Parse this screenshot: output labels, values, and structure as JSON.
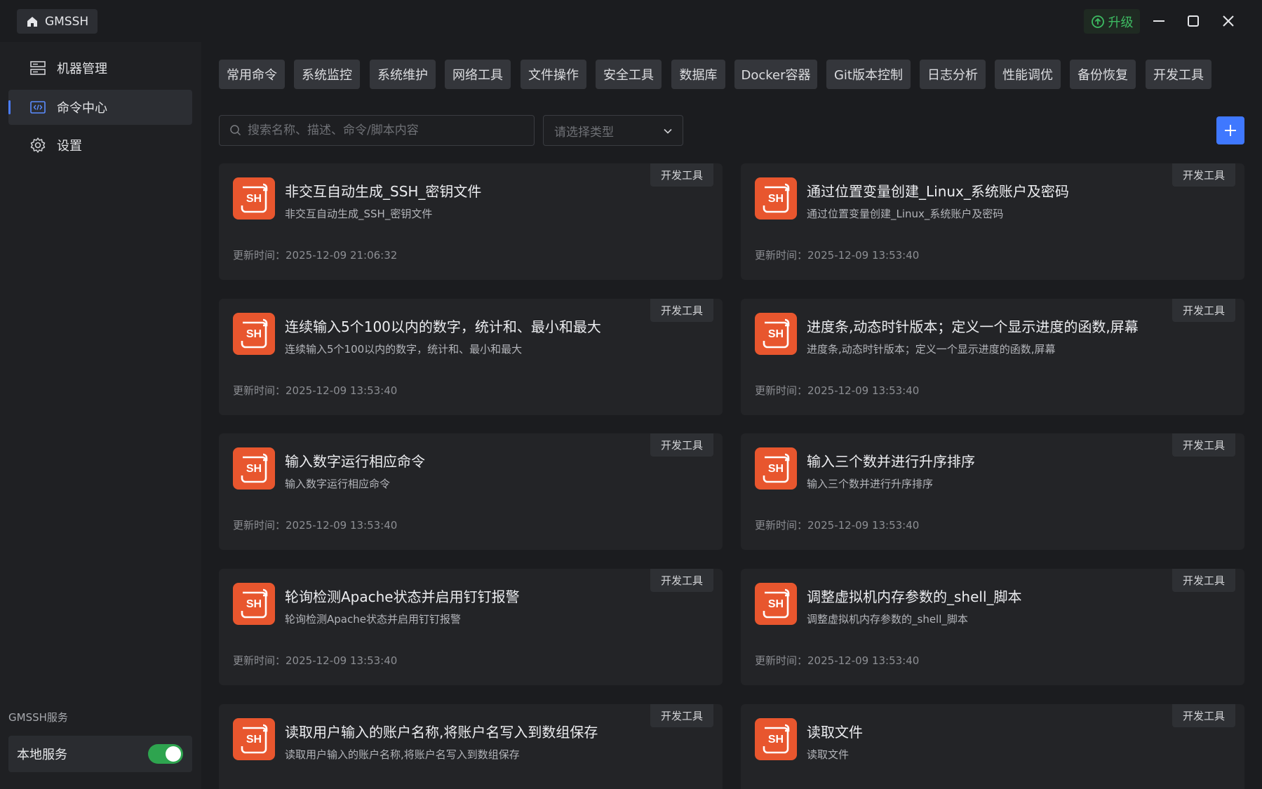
{
  "app": {
    "name": "GMSSH",
    "upgrade_label": "升级"
  },
  "colors": {
    "accent": "#3f78ff",
    "success": "#2ea44f",
    "sh_icon": "#e8562e"
  },
  "sidebar": {
    "items": [
      {
        "label": "机器管理",
        "icon": "server-icon"
      },
      {
        "label": "命令中心",
        "icon": "code-window-icon",
        "active": true
      },
      {
        "label": "设置",
        "icon": "gear-icon"
      }
    ],
    "service_section_label": "GMSSH服务",
    "local_service": {
      "label": "本地服务",
      "enabled": true
    }
  },
  "tags": [
    "常用命令",
    "系统监控",
    "系统维护",
    "网络工具",
    "文件操作",
    "安全工具",
    "数据库",
    "Docker容器",
    "Git版本控制",
    "日志分析",
    "性能调优",
    "备份恢复",
    "开发工具"
  ],
  "search": {
    "placeholder": "搜索名称、描述、命令/脚本内容",
    "value": ""
  },
  "type_select": {
    "placeholder": "请选择类型"
  },
  "updated_label": "更新时间：",
  "cards": [
    {
      "title": "非交互自动生成_SSH_密钥文件",
      "desc": "非交互自动生成_SSH_密钥文件",
      "tag": "开发工具",
      "updated": "2025-12-09 21:06:32",
      "icon_text": "SH"
    },
    {
      "title": "通过位置变量创建_Linux_系统账户及密码",
      "desc": "通过位置变量创建_Linux_系统账户及密码",
      "tag": "开发工具",
      "updated": "2025-12-09 13:53:40",
      "icon_text": "SH"
    },
    {
      "title": "连续输入5个100以内的数字，统计和、最小和最大",
      "desc": "连续输入5个100以内的数字，统计和、最小和最大",
      "tag": "开发工具",
      "updated": "2025-12-09 13:53:40",
      "icon_text": "SH"
    },
    {
      "title": "进度条,动态时针版本；定义一个显示进度的函数,屏幕",
      "desc": "进度条,动态时针版本；定义一个显示进度的函数,屏幕",
      "tag": "开发工具",
      "updated": "2025-12-09 13:53:40",
      "icon_text": "SH"
    },
    {
      "title": "输入数字运行相应命令",
      "desc": "输入数字运行相应命令",
      "tag": "开发工具",
      "updated": "2025-12-09 13:53:40",
      "icon_text": "SH"
    },
    {
      "title": "输入三个数并进行升序排序",
      "desc": "输入三个数并进行升序排序",
      "tag": "开发工具",
      "updated": "2025-12-09 13:53:40",
      "icon_text": "SH"
    },
    {
      "title": "轮询检测Apache状态并启用钉钉报警",
      "desc": "轮询检测Apache状态并启用钉钉报警",
      "tag": "开发工具",
      "updated": "2025-12-09 13:53:40",
      "icon_text": "SH"
    },
    {
      "title": "调整虚拟机内存参数的_shell_脚本",
      "desc": "调整虚拟机内存参数的_shell_脚本",
      "tag": "开发工具",
      "updated": "2025-12-09 13:53:40",
      "icon_text": "SH"
    },
    {
      "title": "读取用户输入的账户名称,将账户名写入到数组保存",
      "desc": "读取用户输入的账户名称,将账户名写入到数组保存",
      "tag": "开发工具",
      "updated": "",
      "icon_text": "SH"
    },
    {
      "title": "读取文件",
      "desc": "读取文件",
      "tag": "开发工具",
      "updated": "",
      "icon_text": "SH"
    }
  ]
}
